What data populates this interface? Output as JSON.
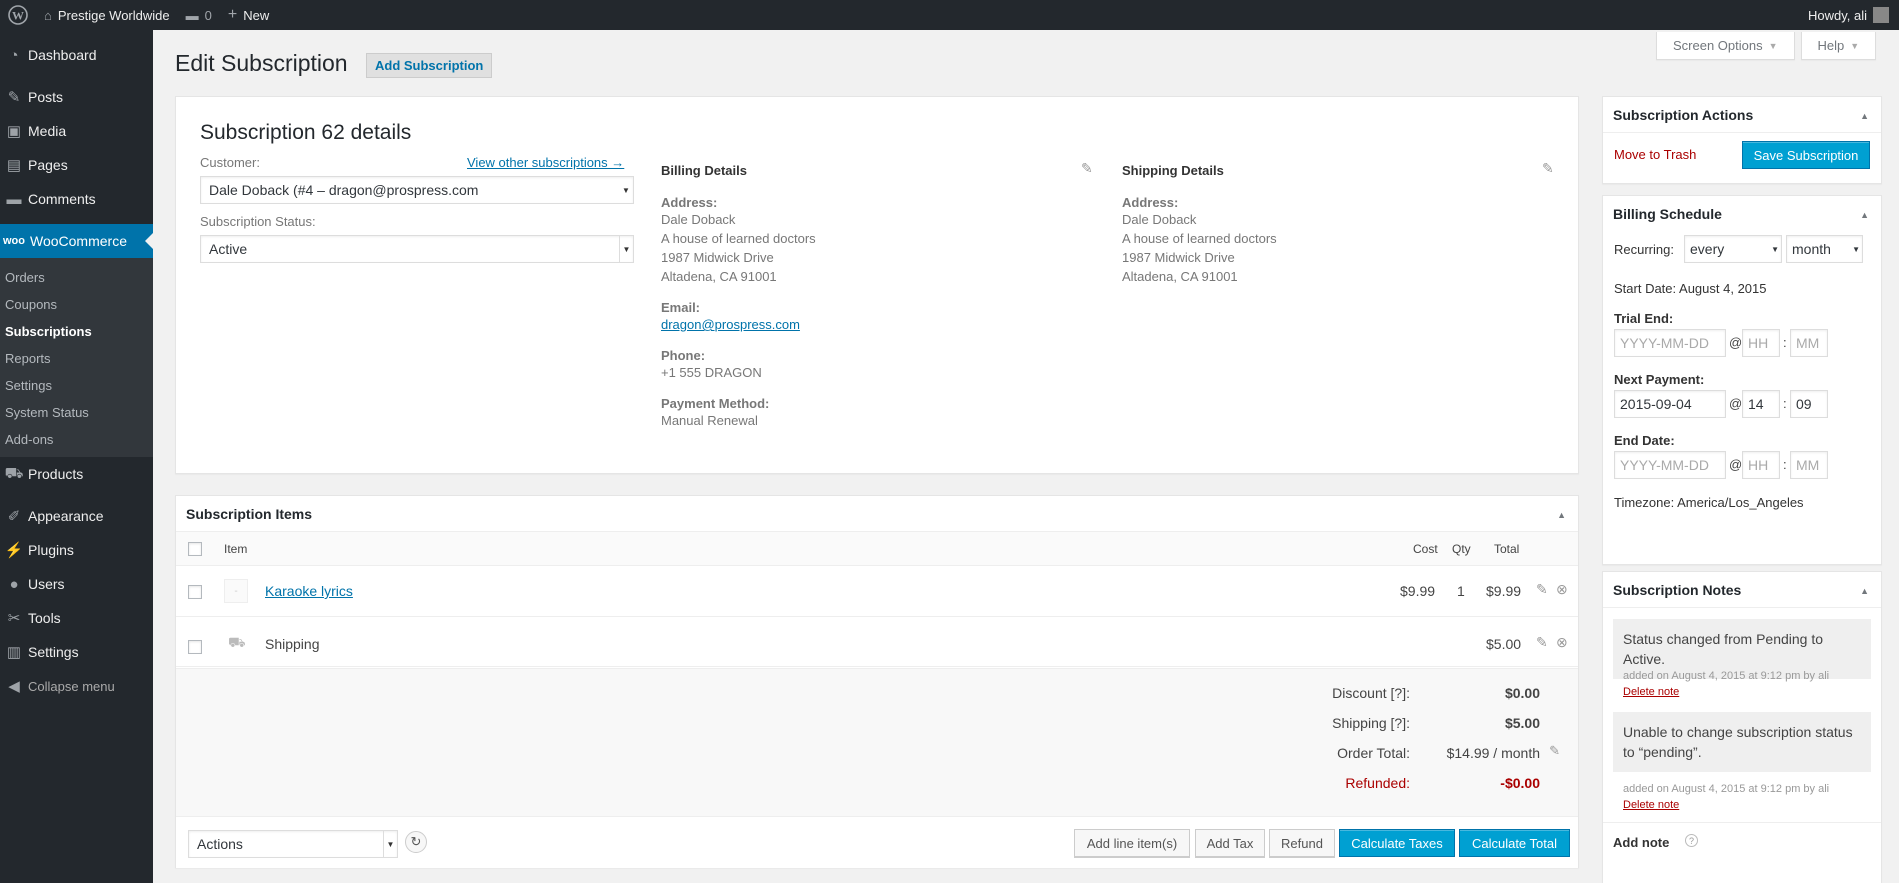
{
  "admin_bar": {
    "site_name": "Prestige Worldwide",
    "comments_count": "0",
    "new_label": "New",
    "howdy": "Howdy, ali"
  },
  "sidebar": {
    "items": [
      {
        "label": "Dashboard",
        "icon": "dashboard-icon"
      },
      {
        "label": "Posts",
        "icon": "pin-icon"
      },
      {
        "label": "Media",
        "icon": "media-icon"
      },
      {
        "label": "Pages",
        "icon": "page-icon"
      },
      {
        "label": "Comments",
        "icon": "comment-icon"
      },
      {
        "label": "WooCommerce",
        "icon": "woo-icon"
      },
      {
        "label": "Products",
        "icon": "cart-icon"
      },
      {
        "label": "Appearance",
        "icon": "brush-icon"
      },
      {
        "label": "Plugins",
        "icon": "plugin-icon"
      },
      {
        "label": "Users",
        "icon": "user-icon"
      },
      {
        "label": "Tools",
        "icon": "wrench-icon"
      },
      {
        "label": "Settings",
        "icon": "settings-icon"
      },
      {
        "label": "Collapse menu",
        "icon": "collapse-icon"
      }
    ],
    "woo_submenu": [
      "Orders",
      "Coupons",
      "Subscriptions",
      "Reports",
      "Settings",
      "System Status",
      "Add-ons"
    ]
  },
  "screen_meta": {
    "screen_options": "Screen Options",
    "help": "Help"
  },
  "page": {
    "title": "Edit Subscription",
    "add_button": "Add Subscription"
  },
  "details": {
    "heading": "Subscription 62 details",
    "customer_label": "Customer:",
    "view_other": "View other subscriptions →",
    "customer_value": "Dale Doback (#4 – dragon@prospress.com",
    "status_label": "Subscription Status:",
    "status_value": "Active",
    "billing": {
      "heading": "Billing Details",
      "address_label": "Address:",
      "address": [
        "Dale Doback",
        "A house of learned doctors",
        "1987 Midwick Drive",
        "Altadena, CA 91001"
      ],
      "email_label": "Email:",
      "email": "dragon@prospress.com",
      "phone_label": "Phone:",
      "phone": "+1 555 DRAGON",
      "payment_label": "Payment Method:",
      "payment": "Manual Renewal"
    },
    "shipping": {
      "heading": "Shipping Details",
      "address_label": "Address:",
      "address": [
        "Dale Doback",
        "A house of learned doctors",
        "1987 Midwick Drive",
        "Altadena, CA 91001"
      ]
    }
  },
  "items": {
    "heading": "Subscription Items",
    "columns": {
      "item": "Item",
      "cost": "Cost",
      "qty": "Qty",
      "total": "Total"
    },
    "rows": [
      {
        "name": "Karaoke lyrics",
        "cost": "$9.99",
        "qty": "1",
        "total": "$9.99"
      },
      {
        "name": "Shipping",
        "total": "$5.00"
      }
    ],
    "totals": {
      "discount_label": "Discount [?]:",
      "discount": "$0.00",
      "shipping_label": "Shipping [?]:",
      "shipping": "$5.00",
      "order_total_label": "Order Total:",
      "order_total": "$14.99 / month",
      "refunded_label": "Refunded:",
      "refunded": "-$0.00"
    },
    "actions_select": "Actions",
    "buttons": {
      "add_line": "Add line item(s)",
      "add_tax": "Add Tax",
      "refund": "Refund",
      "calc_taxes": "Calculate Taxes",
      "calc_total": "Calculate Total"
    }
  },
  "sub_actions": {
    "heading": "Subscription Actions",
    "trash": "Move to Trash",
    "save": "Save Subscription"
  },
  "billing_schedule": {
    "heading": "Billing Schedule",
    "recurring_label": "Recurring:",
    "interval": "every",
    "period": "month",
    "start_date": "Start Date: August 4, 2015",
    "trial_end_label": "Trial End:",
    "next_payment_label": "Next Payment:",
    "end_date_label": "End Date:",
    "date_placeholder": "YYYY-MM-DD",
    "hh_placeholder": "HH",
    "mm_placeholder": "MM",
    "at": "@",
    "colon": ":",
    "next_payment_date": "2015-09-04",
    "next_payment_hh": "14",
    "next_payment_mm": "09",
    "timezone": "Timezone: America/Los_Angeles"
  },
  "notes": {
    "heading": "Subscription Notes",
    "list": [
      {
        "text": "Status changed from Pending to Active.",
        "meta": "added on August 4, 2015 at 9:12 pm by ali",
        "delete": "Delete note"
      },
      {
        "text": "Unable to change subscription status to “pending”.",
        "meta": "added on August 4, 2015 at 9:12 pm by ali",
        "delete": "Delete note"
      }
    ],
    "add_note": "Add note"
  },
  "colors": {
    "accent": "#0073aa",
    "primary_button": "#00a0d2",
    "danger": "#a00",
    "admin_bg": "#23282d"
  }
}
